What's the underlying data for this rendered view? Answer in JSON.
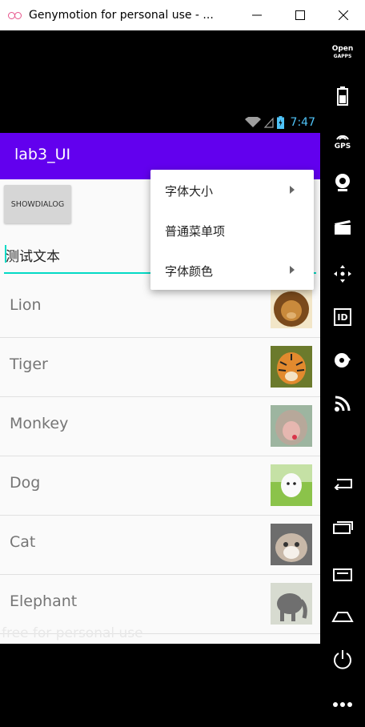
{
  "window": {
    "title": "Genymotion for personal use - ..."
  },
  "status_bar": {
    "time": "7:47"
  },
  "app_bar": {
    "title": "lab3_UI"
  },
  "main": {
    "dialog_button_label": "SHOWDIALOG",
    "edit_text_value": "测试文本",
    "list_items": [
      {
        "name": "Lion",
        "image": "lion-photo"
      },
      {
        "name": "Tiger",
        "image": "tiger-photo"
      },
      {
        "name": "Monkey",
        "image": "monkey-photo"
      },
      {
        "name": "Dog",
        "image": "dog-photo"
      },
      {
        "name": "Cat",
        "image": "cat-photo"
      },
      {
        "name": "Elephant",
        "image": "elephant-photo"
      }
    ],
    "watermark": "free for personal use"
  },
  "popup_menu": {
    "items": [
      {
        "label": "字体大小",
        "has_submenu": true
      },
      {
        "label": "普通菜单项",
        "has_submenu": false
      },
      {
        "label": "字体颜色",
        "has_submenu": true
      }
    ]
  },
  "sidebar": {
    "open_gapps_label": [
      "Open",
      "GAPPS"
    ],
    "gps_label": "GPS",
    "id_label": "ID"
  },
  "colors": {
    "app_bar": "#6200ee",
    "accent": "#03dac5",
    "status_time": "#4fc3f7"
  }
}
